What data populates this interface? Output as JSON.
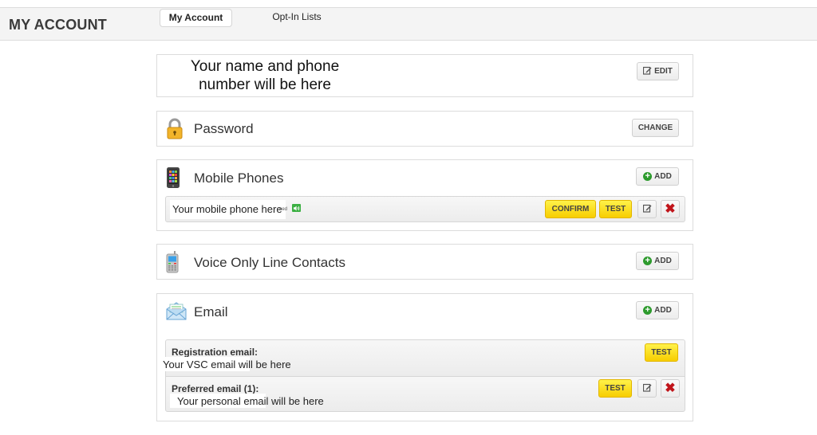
{
  "header": {
    "title": "MY ACCOUNT",
    "tabs": [
      {
        "label": "My Account",
        "active": true
      },
      {
        "label": "Opt-In Lists",
        "active": false
      }
    ]
  },
  "profile": {
    "placeholder_line1": "Your name and phone",
    "placeholder_line2": "number will be here",
    "edit_label": "EDIT"
  },
  "password": {
    "title": "Password",
    "icon": "padlock-icon",
    "change_label": "CHANGE"
  },
  "mobile": {
    "title": "Mobile Phones",
    "icon": "smartphone-icon",
    "add_label": "ADD",
    "entries": [
      {
        "value": "Your mobile phone here",
        "suffix": "ned",
        "confirm_label": "CONFIRM",
        "test_label": "TEST"
      }
    ]
  },
  "voice": {
    "title": "Voice Only Line Contacts",
    "icon": "cellphone-icon",
    "add_label": "ADD"
  },
  "email": {
    "title": "Email",
    "icon": "envelope-icon",
    "add_label": "ADD",
    "registration": {
      "label": "Registration email:",
      "value": "Your VSC email will be here",
      "test_label": "TEST"
    },
    "preferred": {
      "label": "Preferred email (1):",
      "value": "Your personal email will be here",
      "test_label": "TEST"
    }
  },
  "colors": {
    "accent_yellow": "#ffe600",
    "add_green": "#2c9a2c",
    "delete_red": "#c0141a",
    "sound_green": "#3cb043"
  }
}
